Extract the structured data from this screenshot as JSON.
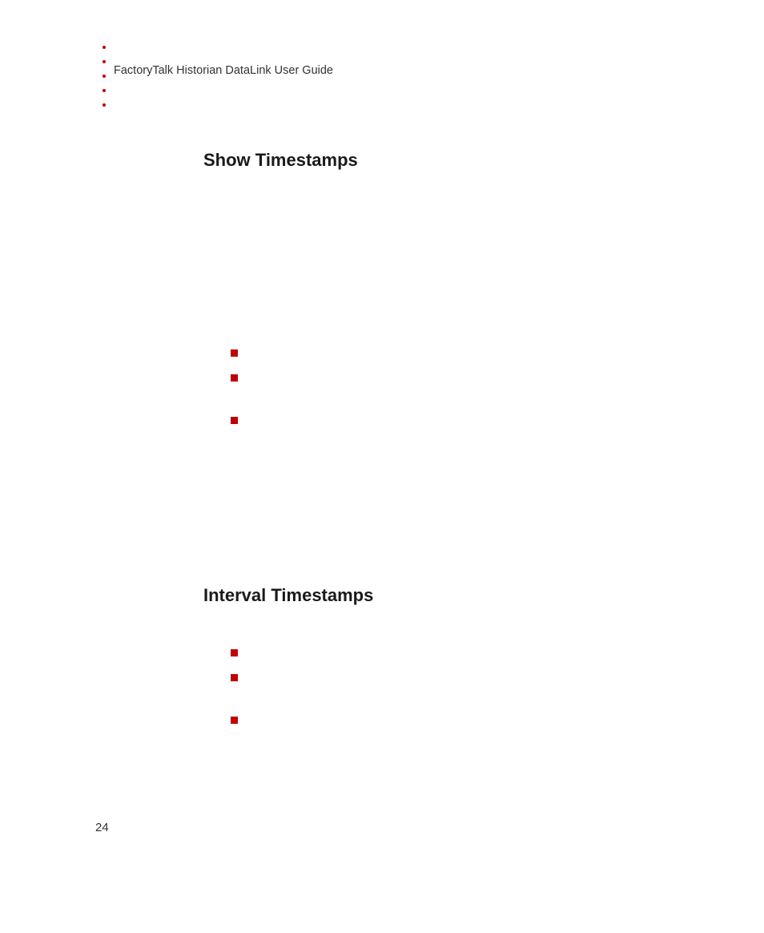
{
  "header": {
    "title": "FactoryTalk Historian DataLink User Guide"
  },
  "sections": {
    "show_timestamps": {
      "heading": "Show Timestamps"
    },
    "interval_timestamps": {
      "heading": "Interval Timestamps"
    }
  },
  "page_number": "24"
}
